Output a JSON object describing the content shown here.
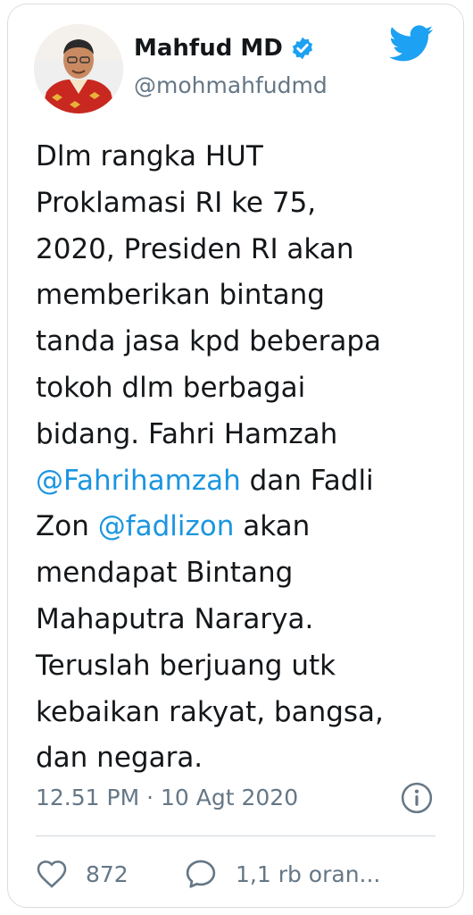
{
  "user": {
    "display_name": "Mahfud MD",
    "handle": "@mohmahfudmd",
    "verified": true
  },
  "tweet": {
    "lines": [
      [
        {
          "text": "Dlm rangka HUT"
        }
      ],
      [
        {
          "text": "Proklamasi RI ke 75,"
        }
      ],
      [
        {
          "text": "2020, Presiden RI akan"
        }
      ],
      [
        {
          "text": "memberikan bintang"
        }
      ],
      [
        {
          "text": "tanda jasa kpd beberapa"
        }
      ],
      [
        {
          "text": "tokoh dlm berbagai"
        }
      ],
      [
        {
          "text": "bidang. Fahri Hamzah"
        }
      ],
      [
        {
          "text": "@Fahrihamzah",
          "mention": true
        },
        {
          "text": " dan Fadli"
        }
      ],
      [
        {
          "text": "Zon "
        },
        {
          "text": "@fadlizon",
          "mention": true
        },
        {
          "text": " akan"
        }
      ],
      [
        {
          "text": "mendapat Bintang"
        }
      ],
      [
        {
          "text": "Mahaputra Nararya."
        }
      ],
      [
        {
          "text": "Teruslah berjuang utk"
        }
      ],
      [
        {
          "text": "kebaikan rakyat, bangsa,"
        }
      ],
      [
        {
          "text": "dan negara."
        }
      ]
    ],
    "timestamp": "12.51 PM · 10 Agt 2020"
  },
  "actions": {
    "likes": "872",
    "replies": "1,1 rb oran..."
  },
  "icons": {
    "brand": "twitter-bird-icon",
    "verified": "verified-badge-icon",
    "info": "info-icon",
    "like": "heart-icon",
    "reply": "speech-bubble-icon"
  },
  "colors": {
    "brand": "#1da1f2",
    "mention": "#1b95e0",
    "secondary_text": "#657786",
    "text": "#14171a"
  }
}
